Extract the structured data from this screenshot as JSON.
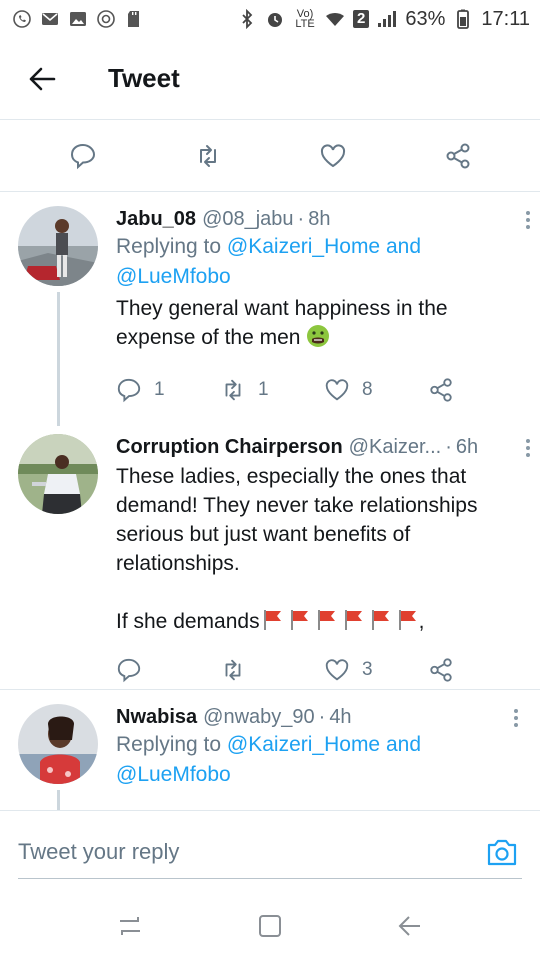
{
  "status_bar": {
    "battery_percent": "63%",
    "time": "17:11",
    "sim_badge": "2",
    "volte": "Vo) LTE"
  },
  "header": {
    "title": "Tweet"
  },
  "tweets": [
    {
      "name": "Jabu_08",
      "handle": "@08_jabu",
      "time": "8h",
      "replying_prefix": "Replying to",
      "mention1": "@Kaizeri_Home",
      "joiner": "and",
      "mention2": "@LueMfobo",
      "text": "They general want happiness in the expense of the men",
      "replies": "1",
      "retweets": "1",
      "likes": "8"
    },
    {
      "name": "Corruption Chairperson",
      "handle": "@Kaizer...",
      "time": "6h",
      "text": "These ladies, especially the ones that demand! They never take relationships serious but just want benefits of relationships.",
      "text2": "If she demands",
      "text2_suffix": ",",
      "likes": "3"
    },
    {
      "name": "Nwabisa",
      "handle": "@nwaby_90",
      "time": "4h",
      "replying_prefix": "Replying to",
      "mention1": "@Kaizeri_Home",
      "joiner": "and",
      "mention2": "@LueMfobo"
    }
  ],
  "reply_bar": {
    "placeholder": "Tweet your reply"
  },
  "colors": {
    "accent": "#1da1f2",
    "secondary_text": "#657786",
    "divider": "#e1e8ed",
    "flag_red": "#e0402f"
  }
}
